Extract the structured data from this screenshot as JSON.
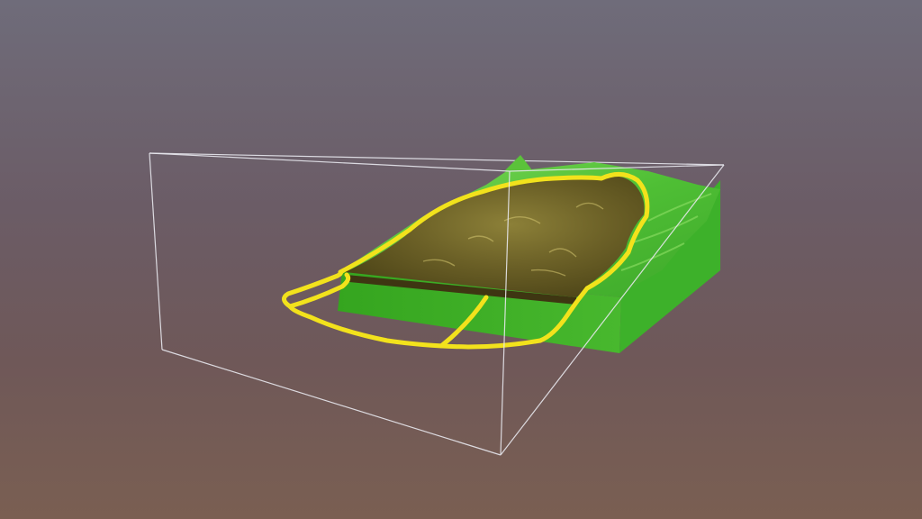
{
  "viewer": {
    "background_top": "#6f6c7a",
    "background_bottom": "#7a5f52"
  },
  "model": {
    "terrain_color": "#3fae2c",
    "terrain_highlight": "#6ed04a",
    "pit_color": "#5a5020",
    "pit_highlight": "#c8b860",
    "boundary_color": "#f2e21c",
    "bounding_box_color": "#e8e8ee"
  }
}
